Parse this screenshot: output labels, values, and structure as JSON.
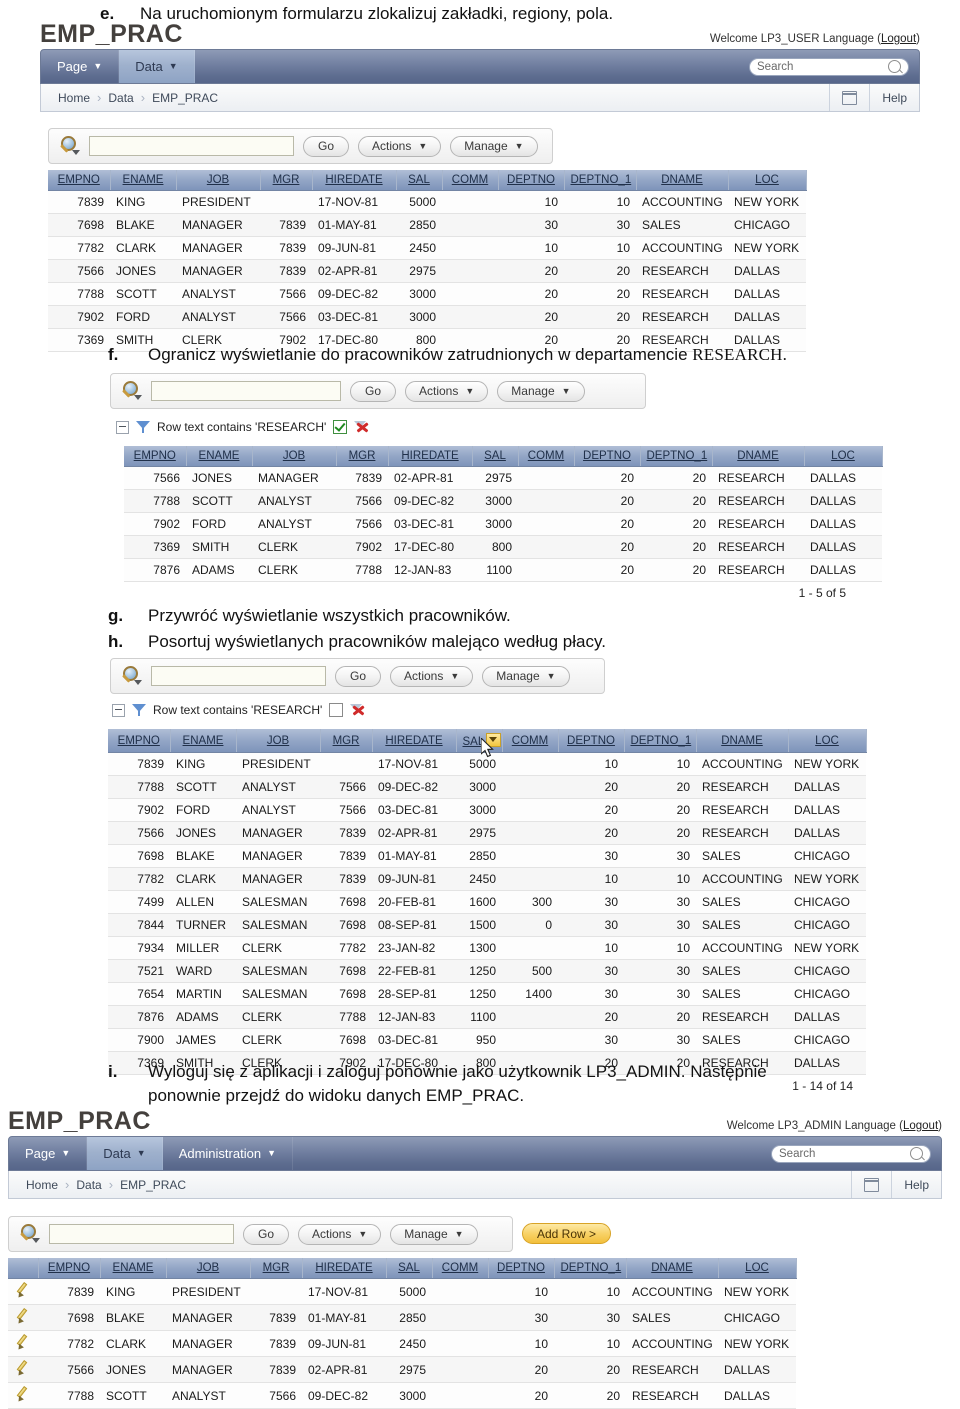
{
  "instructions": {
    "e": {
      "marker": "e.",
      "text": "Na uruchomionym formularzu zlokalizuj zakładki, regiony, pola."
    },
    "f": {
      "marker": "f.",
      "text": "Ogranicz wyświetlanie do pracowników zatrudnionych w departamencie ",
      "emphasis": "RESEARCH."
    },
    "g": {
      "marker": "g.",
      "text": "Przywróć wyświetlanie wszystkich pracowników."
    },
    "h": {
      "marker": "h.",
      "text": "Posortuj wyświetlanych pracowników malejąco według płacy."
    },
    "i": {
      "marker": "i.",
      "line1": "Wyloguj się z aplikacji i zaloguj ponownie jako użytkownik LP3_ADMIN. Następnie",
      "line2": "ponownie przejdź do widoku danych EMP_PRAC."
    }
  },
  "app_user": {
    "logo": "EMP_PRAC",
    "welcome": "Welcome LP3_USER",
    "language": "Language",
    "logout_open": "(",
    "logout": "Logout",
    "logout_close": ")",
    "tabs": [
      {
        "label": "Page",
        "caret": "▼",
        "active": false
      },
      {
        "label": "Data",
        "caret": "▼",
        "active": true
      }
    ],
    "search_placeholder": "Search",
    "breadcrumb": [
      "Home",
      "Data",
      "EMP_PRAC"
    ],
    "help": "Help"
  },
  "app_admin": {
    "logo": "EMP_PRAC",
    "welcome": "Welcome LP3_ADMIN",
    "language": "Language",
    "logout_open": "(",
    "logout": "Logout",
    "logout_close": ")",
    "tabs": [
      {
        "label": "Page",
        "caret": "▼",
        "active": false
      },
      {
        "label": "Data",
        "caret": "▼",
        "active": true
      },
      {
        "label": "Administration",
        "caret": "▼",
        "active": false
      }
    ],
    "search_placeholder": "Search",
    "breadcrumb": [
      "Home",
      "Data",
      "EMP_PRAC"
    ],
    "help": "Help"
  },
  "toolbar": {
    "search_value": "",
    "go_label": "Go",
    "actions_label": "Actions",
    "manage_label": "Manage",
    "add_row_label": "Add Row >",
    "caret": "▼"
  },
  "filter_chip": {
    "label": "Row text contains 'RESEARCH'",
    "enabled_checked": true,
    "disabled_checked": false
  },
  "columns": [
    "EMPNO",
    "ENAME",
    "JOB",
    "MGR",
    "HIREDATE",
    "SAL",
    "COMM",
    "DEPTNO",
    "DEPTNO_1",
    "DNAME",
    "LOC"
  ],
  "report_unfiltered": {
    "rows": [
      [
        "7839",
        "KING",
        "PRESIDENT",
        "",
        "17-NOV-81",
        "5000",
        "",
        "10",
        "10",
        "ACCOUNTING",
        "NEW YORK"
      ],
      [
        "7698",
        "BLAKE",
        "MANAGER",
        "7839",
        "01-MAY-81",
        "2850",
        "",
        "30",
        "30",
        "SALES",
        "CHICAGO"
      ],
      [
        "7782",
        "CLARK",
        "MANAGER",
        "7839",
        "09-JUN-81",
        "2450",
        "",
        "10",
        "10",
        "ACCOUNTING",
        "NEW YORK"
      ],
      [
        "7566",
        "JONES",
        "MANAGER",
        "7839",
        "02-APR-81",
        "2975",
        "",
        "20",
        "20",
        "RESEARCH",
        "DALLAS"
      ],
      [
        "7788",
        "SCOTT",
        "ANALYST",
        "7566",
        "09-DEC-82",
        "3000",
        "",
        "20",
        "20",
        "RESEARCH",
        "DALLAS"
      ],
      [
        "7902",
        "FORD",
        "ANALYST",
        "7566",
        "03-DEC-81",
        "3000",
        "",
        "20",
        "20",
        "RESEARCH",
        "DALLAS"
      ],
      [
        "7369",
        "SMITH",
        "CLERK",
        "7902",
        "17-DEC-80",
        "800",
        "",
        "20",
        "20",
        "RESEARCH",
        "DALLAS"
      ]
    ]
  },
  "report_filtered": {
    "rows": [
      [
        "7566",
        "JONES",
        "MANAGER",
        "7839",
        "02-APR-81",
        "2975",
        "",
        "20",
        "20",
        "RESEARCH",
        "DALLAS"
      ],
      [
        "7788",
        "SCOTT",
        "ANALYST",
        "7566",
        "09-DEC-82",
        "3000",
        "",
        "20",
        "20",
        "RESEARCH",
        "DALLAS"
      ],
      [
        "7902",
        "FORD",
        "ANALYST",
        "7566",
        "03-DEC-81",
        "3000",
        "",
        "20",
        "20",
        "RESEARCH",
        "DALLAS"
      ],
      [
        "7369",
        "SMITH",
        "CLERK",
        "7902",
        "17-DEC-80",
        "800",
        "",
        "20",
        "20",
        "RESEARCH",
        "DALLAS"
      ],
      [
        "7876",
        "ADAMS",
        "CLERK",
        "7788",
        "12-JAN-83",
        "1100",
        "",
        "20",
        "20",
        "RESEARCH",
        "DALLAS"
      ]
    ],
    "pager": "1 - 5 of 5"
  },
  "report_sorted": {
    "sort_column": "SAL",
    "rows": [
      [
        "7839",
        "KING",
        "PRESIDENT",
        "",
        "17-NOV-81",
        "5000",
        "",
        "10",
        "10",
        "ACCOUNTING",
        "NEW YORK"
      ],
      [
        "7788",
        "SCOTT",
        "ANALYST",
        "7566",
        "09-DEC-82",
        "3000",
        "",
        "20",
        "20",
        "RESEARCH",
        "DALLAS"
      ],
      [
        "7902",
        "FORD",
        "ANALYST",
        "7566",
        "03-DEC-81",
        "3000",
        "",
        "20",
        "20",
        "RESEARCH",
        "DALLAS"
      ],
      [
        "7566",
        "JONES",
        "MANAGER",
        "7839",
        "02-APR-81",
        "2975",
        "",
        "20",
        "20",
        "RESEARCH",
        "DALLAS"
      ],
      [
        "7698",
        "BLAKE",
        "MANAGER",
        "7839",
        "01-MAY-81",
        "2850",
        "",
        "30",
        "30",
        "SALES",
        "CHICAGO"
      ],
      [
        "7782",
        "CLARK",
        "MANAGER",
        "7839",
        "09-JUN-81",
        "2450",
        "",
        "10",
        "10",
        "ACCOUNTING",
        "NEW YORK"
      ],
      [
        "7499",
        "ALLEN",
        "SALESMAN",
        "7698",
        "20-FEB-81",
        "1600",
        "300",
        "30",
        "30",
        "SALES",
        "CHICAGO"
      ],
      [
        "7844",
        "TURNER",
        "SALESMAN",
        "7698",
        "08-SEP-81",
        "1500",
        "0",
        "30",
        "30",
        "SALES",
        "CHICAGO"
      ],
      [
        "7934",
        "MILLER",
        "CLERK",
        "7782",
        "23-JAN-82",
        "1300",
        "",
        "10",
        "10",
        "ACCOUNTING",
        "NEW YORK"
      ],
      [
        "7521",
        "WARD",
        "SALESMAN",
        "7698",
        "22-FEB-81",
        "1250",
        "500",
        "30",
        "30",
        "SALES",
        "CHICAGO"
      ],
      [
        "7654",
        "MARTIN",
        "SALESMAN",
        "7698",
        "28-SEP-81",
        "1250",
        "1400",
        "30",
        "30",
        "SALES",
        "CHICAGO"
      ],
      [
        "7876",
        "ADAMS",
        "CLERK",
        "7788",
        "12-JAN-83",
        "1100",
        "",
        "20",
        "20",
        "RESEARCH",
        "DALLAS"
      ],
      [
        "7900",
        "JAMES",
        "CLERK",
        "7698",
        "03-DEC-81",
        "950",
        "",
        "30",
        "30",
        "SALES",
        "CHICAGO"
      ],
      [
        "7369",
        "SMITH",
        "CLERK",
        "7902",
        "17-DEC-80",
        "800",
        "",
        "20",
        "20",
        "RESEARCH",
        "DALLAS"
      ]
    ],
    "pager": "1 - 14 of 14"
  },
  "report_admin": {
    "rows": [
      [
        "7839",
        "KING",
        "PRESIDENT",
        "",
        "17-NOV-81",
        "5000",
        "",
        "10",
        "10",
        "ACCOUNTING",
        "NEW YORK"
      ],
      [
        "7698",
        "BLAKE",
        "MANAGER",
        "7839",
        "01-MAY-81",
        "2850",
        "",
        "30",
        "30",
        "SALES",
        "CHICAGO"
      ],
      [
        "7782",
        "CLARK",
        "MANAGER",
        "7839",
        "09-JUN-81",
        "2450",
        "",
        "10",
        "10",
        "ACCOUNTING",
        "NEW YORK"
      ],
      [
        "7566",
        "JONES",
        "MANAGER",
        "7839",
        "02-APR-81",
        "2975",
        "",
        "20",
        "20",
        "RESEARCH",
        "DALLAS"
      ],
      [
        "7788",
        "SCOTT",
        "ANALYST",
        "7566",
        "09-DEC-82",
        "3000",
        "",
        "20",
        "20",
        "RESEARCH",
        "DALLAS"
      ]
    ]
  },
  "colors": {
    "navbar_top": "#8e9bb6",
    "navbar_bottom": "#57668a",
    "navbar_active": "#9fb1cd",
    "header_row": "#93a6c6",
    "add_row_gold": "#f2bf3c",
    "filter_blue": "#5f8fd0",
    "filter_red": "#d02b2b"
  }
}
